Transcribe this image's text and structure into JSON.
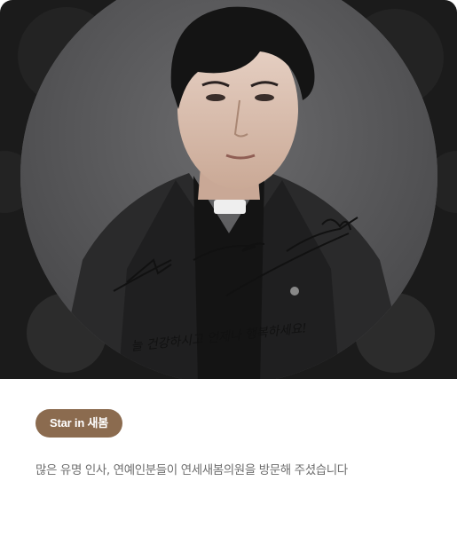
{
  "card": {
    "badge_label": "Star in 새봄",
    "description": "많은 유명 인사, 연예인분들이 연세새봄의원을 방문해 주셨습니다"
  },
  "image": {
    "subject": "signed celebrity portrait photo (circular)",
    "signature_text": "늘 건강하시고 언제나 행복하세요!"
  },
  "colors": {
    "badge_bg": "#8b6b4f",
    "hero_bg": "#1b1b1b",
    "desc_text": "#6e6e6e"
  }
}
